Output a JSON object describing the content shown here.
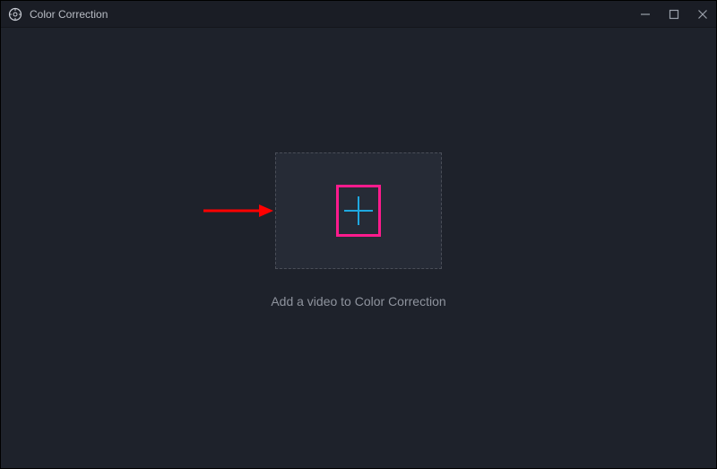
{
  "window": {
    "title": "Color Correction"
  },
  "main": {
    "caption": "Add a video to Color Correction"
  },
  "colors": {
    "highlight": "#ff1b8d",
    "arrow": "#ff0000",
    "plus": "#1fa8e0"
  }
}
